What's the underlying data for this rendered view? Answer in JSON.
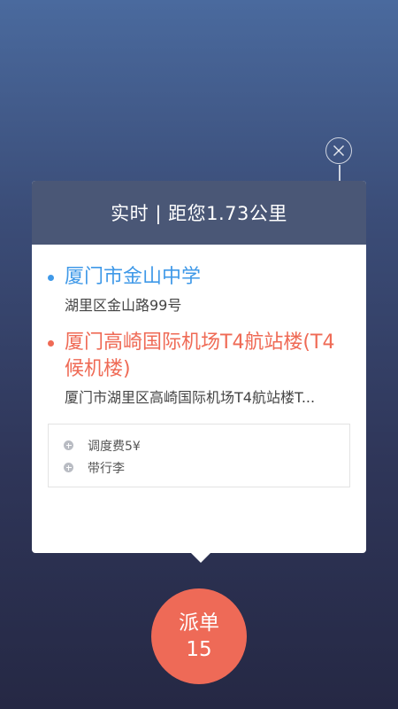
{
  "header": {
    "title": "实时 | 距您1.73公里"
  },
  "route": {
    "start": {
      "name": "厦门市金山中学",
      "address": "湖里区金山路99号",
      "color": "#3f99e8"
    },
    "end": {
      "name": "厦门高崎国际机场T4航站楼(T4候机楼)",
      "address": "厦门市湖里区高崎国际机场T4航站楼T...",
      "color": "#ef6a55"
    }
  },
  "extras": [
    {
      "label": "调度费5¥",
      "icon": "plus-circle-icon"
    },
    {
      "label": "带行李",
      "icon": "plus-circle-icon"
    }
  ],
  "dispatch": {
    "label": "派单",
    "count": "15",
    "color": "#ee6a57"
  },
  "close": {
    "icon": "close-icon"
  }
}
